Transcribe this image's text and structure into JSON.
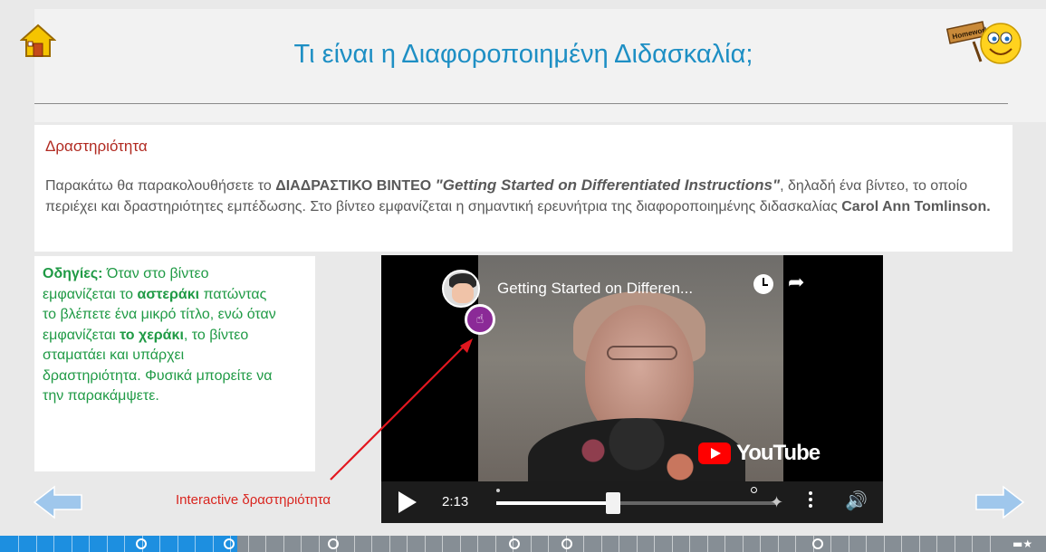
{
  "header": {
    "title": "Τι είναι η Διαφοροποιημένη Διδασκαλία;",
    "home_icon": "home-icon",
    "homework_icon": "homework-smiley-icon",
    "homework_sign": "Homework"
  },
  "activity": {
    "title": "Δραστηριότητα",
    "text_1": "Παρακάτω θα παρακολουθήσετε το ",
    "bold_video": "ΔΙΑΔΡΑΣΤΙΚΟ ΒΙΝΤΕΟ",
    "space_1": " ",
    "video_name": "\"Getting Started on Differentiated Instructions\"",
    "text_2": ", δηλαδή ένα βίντεο, το οποίο περιέχει και δραστηριότητες εμπέδωσης. Στο βίντεο εμφανίζεται η σημαντική ερευνήτρια της διαφοροποιημένης διδασκαλίας ",
    "researcher": "Carol Ann Tomlinson."
  },
  "instructions": {
    "label": "Οδηγίες:",
    "text_1": " Όταν στο βίντεο εμφανίζεται το ",
    "star_word": "αστεράκι",
    "text_2": " πατώντας το βλέπετε ένα μικρό τίτλο, ενώ όταν εμφανίζεται ",
    "hand_word": "το χεράκι",
    "text_3": ", το βίντεο σταματάει και υπάρχει δραστηριότητα. Φυσικά μπορείτε να την παρακάμψετε."
  },
  "video": {
    "title": "Getting Started on Differen...",
    "current_time": "2:13",
    "brand": "YouTube",
    "progress_fraction": 0.41,
    "icons": [
      "play-icon",
      "clock-icon",
      "share-icon",
      "hand-pointer-icon",
      "more-vert-icon",
      "volume-icon",
      "star-icon"
    ]
  },
  "annotation": {
    "label": "Interactive δραστηριότητα",
    "color": "#d9251f"
  },
  "navigation": {
    "prev_icon": "arrow-left-icon",
    "next_icon": "arrow-right-icon"
  },
  "progress_bar": {
    "fill_fraction": 0.227,
    "accent": "#1d8fe0",
    "end_icon": "star-icon"
  }
}
